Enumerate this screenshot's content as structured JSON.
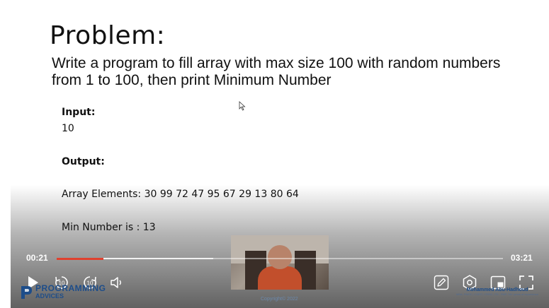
{
  "slide": {
    "title": "Problem:",
    "statement": "Write a program to fill array with max size 100 with random numbers from 1 to 100, then print Minimum Number",
    "input_label": "Input:",
    "input_value": "10",
    "output_label": "Output:",
    "array_line": "Array Elements: 30 99 72 47 95 67 29 13 80 64",
    "min_line": "Min Number is : 13"
  },
  "player": {
    "current_time": "00:21",
    "total_time": "03:21",
    "progress_fraction": 0.104,
    "buffered_fraction": 0.35,
    "rewind_seconds": "10",
    "forward_seconds": "10",
    "accent_color": "#e0412f",
    "icons": {
      "play": "play-icon",
      "rewind": "rewind-10-icon",
      "forward": "forward-10-icon",
      "volume": "volume-icon",
      "annotate": "pencil-icon",
      "settings": "settings-icon",
      "pip": "picture-in-picture-icon",
      "fullscreen": "fullscreen-icon"
    }
  },
  "branding": {
    "logo_line1": "PROGRAMMING",
    "logo_line2": "ADVICES",
    "copyright": "Copyright© 2022",
    "author_name": "Mohammed Abu-Hadhoud",
    "author_degrees": "MBA, PMOC, CGEIT, CRISC, ITIL, PMP, 26+ years of experience"
  }
}
